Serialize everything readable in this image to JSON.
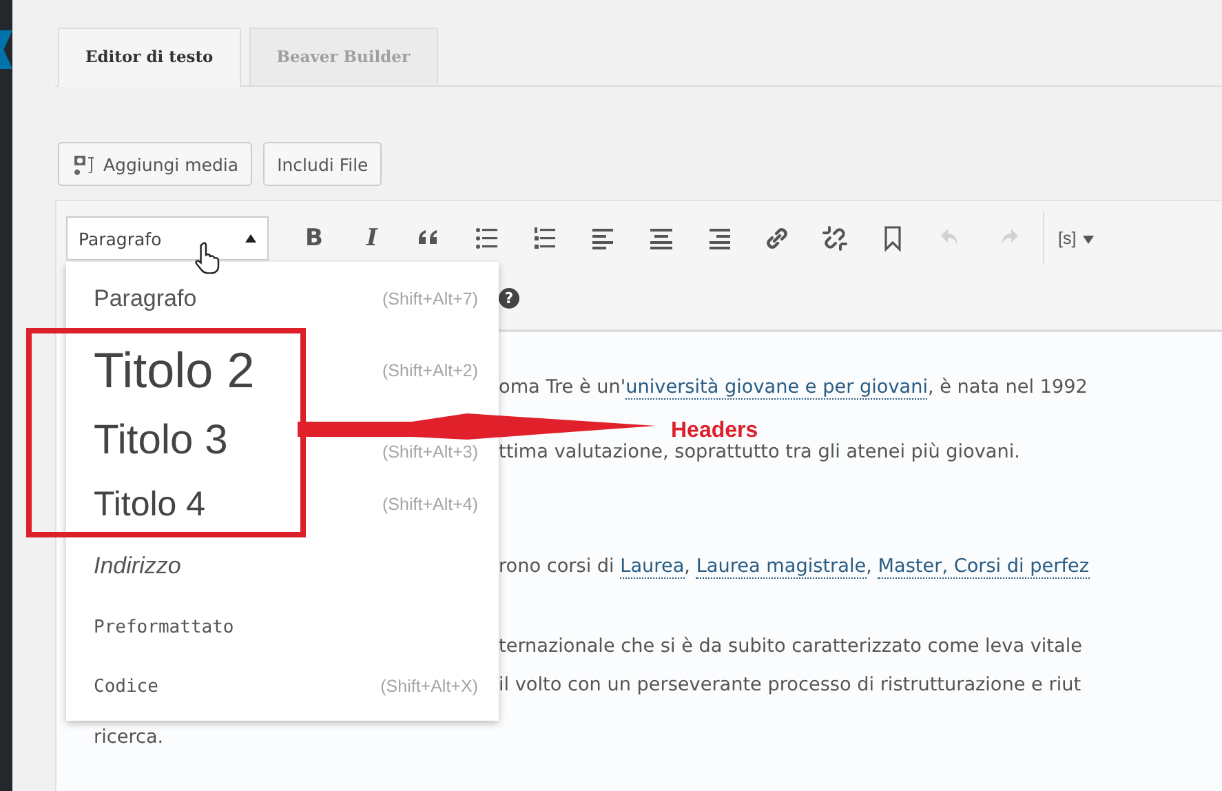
{
  "tabs": [
    {
      "label": "Editor di testo",
      "selected": true
    },
    {
      "label": "Beaver Builder",
      "selected": false
    }
  ],
  "media_buttons": [
    {
      "kind": "media",
      "label": "Aggiungi media"
    },
    {
      "kind": "plain",
      "label": "Includi File"
    }
  ],
  "toolbar": {
    "format_select": {
      "value": "Paragrafo"
    },
    "buttons": [
      {
        "kind": "bold",
        "label": "B",
        "disabled": false
      },
      {
        "kind": "italic",
        "label": "I",
        "disabled": false
      },
      {
        "kind": "quote",
        "disabled": false
      },
      {
        "kind": "bullets",
        "disabled": false
      },
      {
        "kind": "numbers",
        "disabled": false
      },
      {
        "kind": "align-left",
        "disabled": false
      },
      {
        "kind": "align-center",
        "disabled": false
      },
      {
        "kind": "align-right",
        "disabled": false
      },
      {
        "kind": "link",
        "disabled": false
      },
      {
        "kind": "unlink",
        "disabled": false
      },
      {
        "kind": "bookmark",
        "disabled": false
      },
      {
        "kind": "undo",
        "disabled": true
      },
      {
        "kind": "redo",
        "disabled": true
      },
      {
        "kind": "separator"
      },
      {
        "kind": "shortcode",
        "label": "[s]",
        "disabled": false
      }
    ],
    "help": {
      "label": "?"
    }
  },
  "format_menu": [
    {
      "kind": "p",
      "label": "Paragrafo",
      "shortcut": "(Shift+Alt+7)"
    },
    {
      "kind": "h2",
      "label": "Titolo 2",
      "shortcut": "(Shift+Alt+2)"
    },
    {
      "kind": "h3",
      "label": "Titolo 3",
      "shortcut": "(Shift+Alt+3)"
    },
    {
      "kind": "h4",
      "label": "Titolo 4",
      "shortcut": "(Shift+Alt+4)"
    },
    {
      "kind": "address",
      "label": "Indirizzo"
    },
    {
      "kind": "pre",
      "label": "Preformattato"
    },
    {
      "kind": "code",
      "label": "Codice",
      "shortcut": "(Shift+Alt+X)"
    }
  ],
  "content": [
    {
      "beside_menu": true,
      "segments": [
        {
          "text": "oma Tre è un'",
          "link": false
        },
        {
          "text": "università giovane e per giovani",
          "link": true
        },
        {
          "text": ", è nata nel 1992",
          "link": false
        }
      ]
    },
    {
      "beside_menu": true,
      "segments": [
        {
          "text": "ttima valutazione, soprattutto tra gli atenei più giovani.",
          "link": false
        }
      ]
    },
    {
      "beside_menu": true,
      "segments": [
        {
          "text": "rono corsi di ",
          "link": false
        },
        {
          "text": "Laurea",
          "link": true
        },
        {
          "text": ", ",
          "link": false
        },
        {
          "text": "Laurea magistrale",
          "link": true
        },
        {
          "text": ", ",
          "link": false
        },
        {
          "text": "Master, Corsi di perfez",
          "link": true
        }
      ]
    },
    {
      "beside_menu": true,
      "segments": [
        {
          "text": "ternazionale che si è da subito caratterizzato come leva vitale",
          "link": false
        }
      ]
    },
    {
      "beside_menu": true,
      "segments": [
        {
          "text": "il volto con un perseverante processo di ristrutturazione e riut",
          "link": false
        }
      ]
    },
    {
      "beside_menu": false,
      "segments": [
        {
          "text": "ricerca.",
          "link": false
        }
      ]
    }
  ],
  "annotation": {
    "label": "Headers"
  }
}
